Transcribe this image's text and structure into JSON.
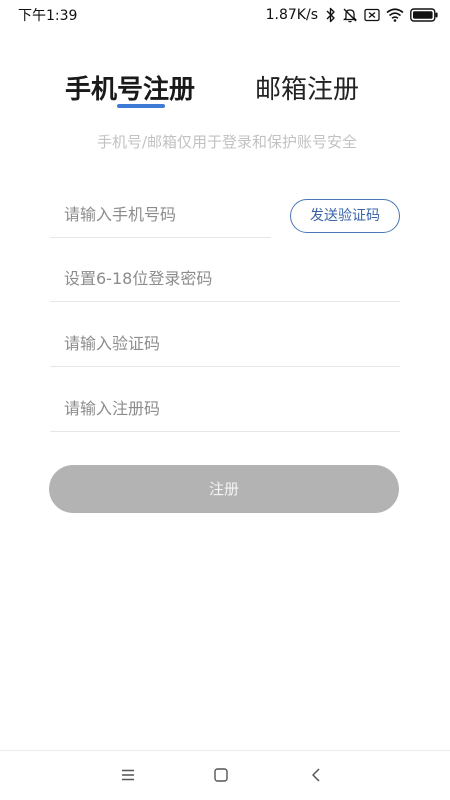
{
  "status_bar": {
    "time": "下午1:39",
    "net_speed": "1.87K/s",
    "icons": [
      "bluetooth-icon",
      "mute-icon",
      "sim-icon",
      "wifi-icon",
      "battery-icon"
    ]
  },
  "tabs": [
    {
      "label": "手机号注册",
      "active": true
    },
    {
      "label": "邮箱注册",
      "active": false
    }
  ],
  "subtitle": "手机号/邮箱仅用于登录和保护账号安全",
  "form": {
    "phone_placeholder": "请输入手机号码",
    "send_code_label": "发送验证码",
    "password_placeholder": "设置6-18位登录密码",
    "code_placeholder": "请输入验证码",
    "reg_code_placeholder": "请输入注册码",
    "submit_label": "注册"
  },
  "nav_bar": {
    "buttons": [
      "menu-icon",
      "home-icon",
      "back-icon"
    ]
  },
  "colors": {
    "accent": "#3d7bd6",
    "button_disabled": "#b3b3b3",
    "outline_button": "#4a78b8",
    "placeholder": "#8c8c8c",
    "subtitle": "#c2c2c2"
  }
}
